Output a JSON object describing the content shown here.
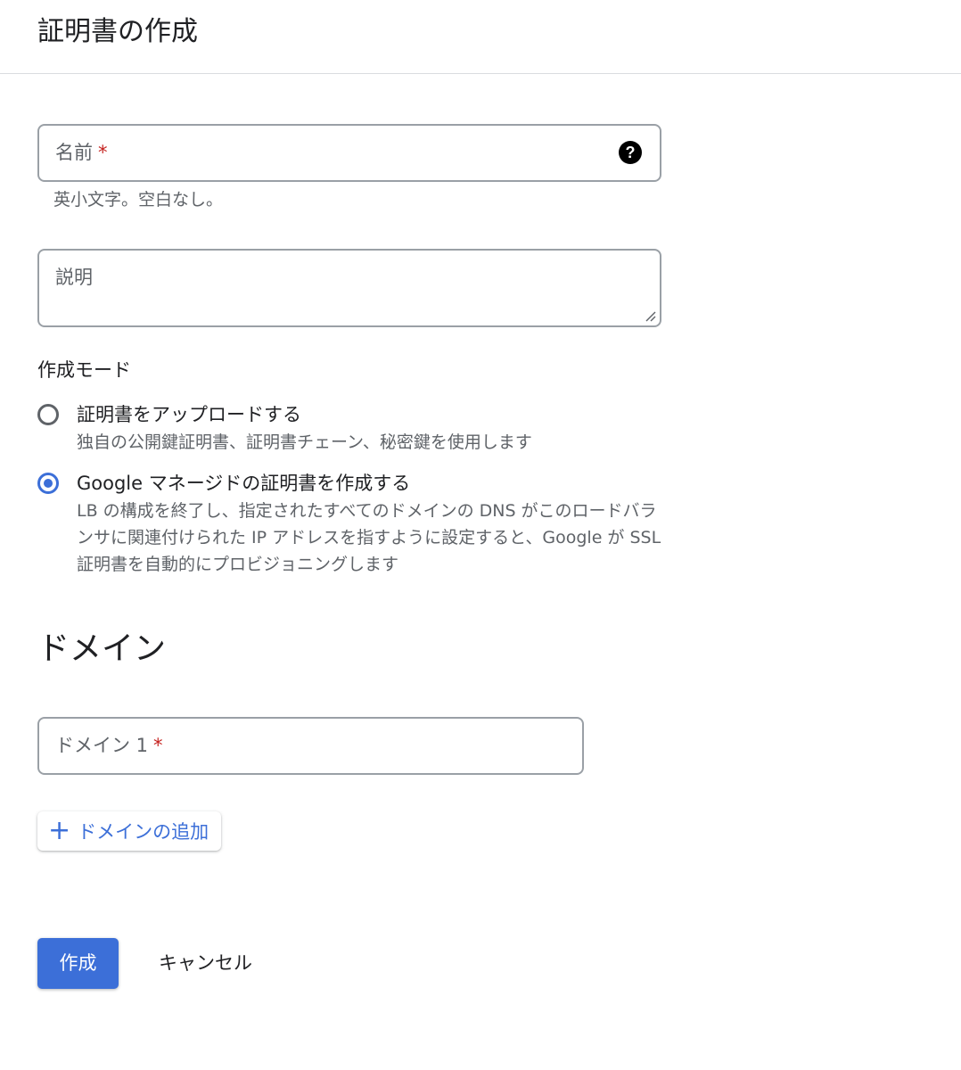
{
  "header": {
    "title": "証明書の作成"
  },
  "form": {
    "name_field": {
      "label": "名前",
      "required_mark": "*",
      "help_icon": "help-circle-icon",
      "hint": "英小文字。空白なし。"
    },
    "description_field": {
      "label": "説明"
    },
    "creation_mode": {
      "label": "作成モード",
      "options": [
        {
          "title": "証明書をアップロードする",
          "description": "独自の公開鍵証明書、証明書チェーン、秘密鍵を使用します",
          "selected": false
        },
        {
          "title": "Google マネージドの証明書を作成する",
          "description": "LB の構成を終了し、指定されたすべてのドメインの DNS がこのロードバランサに関連付けられた IP アドレスを指すように設定すると、Google が SSL 証明書を自動的にプロビジョニングします",
          "selected": true
        }
      ]
    }
  },
  "domains": {
    "heading": "ドメイン",
    "fields": [
      {
        "label": "ドメイン 1",
        "required_mark": "*"
      }
    ],
    "add_button_label": "ドメインの追加",
    "add_icon": "plus-icon"
  },
  "actions": {
    "create_label": "作成",
    "cancel_label": "キャンセル"
  },
  "colors": {
    "accent": "#3c6fd8",
    "required": "#c5221f",
    "border": "#9aa0a6",
    "secondary_text": "#5f6368"
  }
}
